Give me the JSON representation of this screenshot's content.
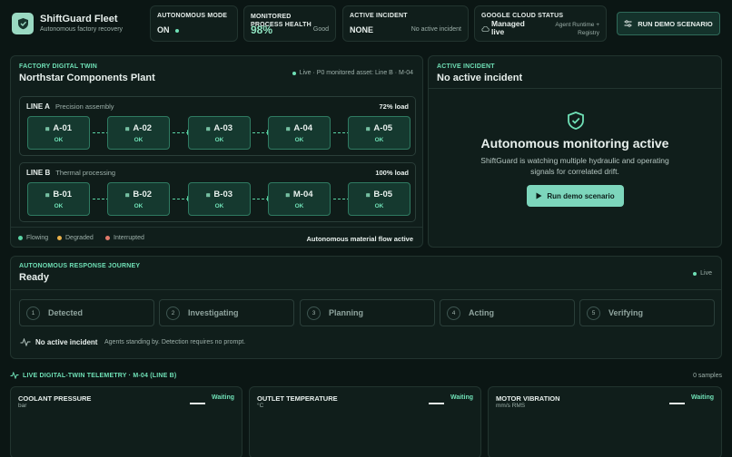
{
  "brand": {
    "title": "ShiftGuard Fleet",
    "subtitle": "Autonomous factory recovery"
  },
  "header": {
    "autonomous_mode": {
      "label": "Autonomous mode",
      "value": "ON"
    },
    "monitored_health": {
      "label": "Monitored process health",
      "value": "98%",
      "status": "Good"
    },
    "active_incident": {
      "label": "Active incident",
      "value": "NONE",
      "status": "No active incident"
    },
    "cloud_status": {
      "label": "Google Cloud status",
      "value": "Managed live",
      "detail": "Agent Runtime + Registry"
    },
    "run_button": "RUN DEMO SCENARIO"
  },
  "twin": {
    "section_label": "Factory digital twin",
    "plant_name": "Northstar Components Plant",
    "live_text": "Live · P0 monitored asset: Line B · M-04",
    "lines": [
      {
        "name": "LINE A",
        "desc": "Precision assembly",
        "load": "72% load",
        "nodes": [
          {
            "id": "A-01",
            "status": "OK"
          },
          {
            "id": "A-02",
            "status": "OK"
          },
          {
            "id": "A-03",
            "status": "OK"
          },
          {
            "id": "A-04",
            "status": "OK"
          },
          {
            "id": "A-05",
            "status": "OK"
          }
        ]
      },
      {
        "name": "LINE B",
        "desc": "Thermal processing",
        "load": "100% load",
        "nodes": [
          {
            "id": "B-01",
            "status": "OK"
          },
          {
            "id": "B-02",
            "status": "OK"
          },
          {
            "id": "B-03",
            "status": "OK"
          },
          {
            "id": "M-04",
            "status": "OK"
          },
          {
            "id": "B-05",
            "status": "OK"
          }
        ]
      }
    ],
    "legend": [
      {
        "label": "Flowing",
        "color": "#5ad3a4"
      },
      {
        "label": "Degraded",
        "color": "#e8b04a"
      },
      {
        "label": "Interrupted",
        "color": "#e07a6a"
      }
    ],
    "flow_status": "Autonomous material flow active"
  },
  "incident_panel": {
    "section_label": "Active incident",
    "title": "No active incident",
    "heading": "Autonomous monitoring active",
    "body": "ShiftGuard is watching multiple hydraulic and operating signals for correlated drift.",
    "button": "Run demo scenario"
  },
  "journey": {
    "section_label": "Autonomous response journey",
    "title": "Ready",
    "live": "Live",
    "steps": [
      {
        "num": "1",
        "label": "Detected"
      },
      {
        "num": "2",
        "label": "Investigating"
      },
      {
        "num": "3",
        "label": "Planning"
      },
      {
        "num": "4",
        "label": "Acting"
      },
      {
        "num": "5",
        "label": "Verifying"
      }
    ],
    "status_title": "No active incident",
    "status_text": "Agents standing by. Detection requires no prompt."
  },
  "telemetry": {
    "section_label": "Live digital-twin telemetry · M-04 (Line B)",
    "samples": "0 samples",
    "cards": [
      {
        "title": "COOLANT PRESSURE",
        "unit": "bar",
        "status": "Waiting"
      },
      {
        "title": "OUTLET TEMPERATURE",
        "unit": "°C",
        "status": "Waiting"
      },
      {
        "title": "MOTOR VIBRATION",
        "unit": "mm/s RMS",
        "status": "Waiting"
      }
    ]
  }
}
